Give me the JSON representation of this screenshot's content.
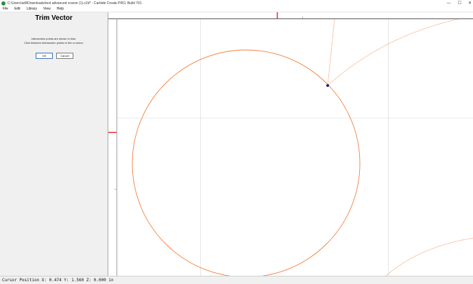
{
  "window": {
    "title": "C:\\Users\\will\\Downloads\\text advanced vcarve (1).c2d* - Carbide Create PRO, Build 761",
    "controls": [
      "—",
      "☐",
      "✕"
    ]
  },
  "menu": {
    "items": [
      "File",
      "Edit",
      "Library",
      "View",
      "Help"
    ]
  },
  "panel": {
    "title": "Trim Vector",
    "line1": "Intersection points are shown in blue.",
    "line2": "Click between intersection points to trim a vector.",
    "ok_label": "OK",
    "cancel_label": "Cancel"
  },
  "canvas": {
    "vector_color": "#f07f3c",
    "grid_color": "#d6d6d6",
    "ruler_marker_color": "#e8242c",
    "intersection_color": "#1a237e"
  },
  "status": {
    "text": "Cursor Position X: 0.474 Y: 1.560 Z: 0.000 in"
  }
}
